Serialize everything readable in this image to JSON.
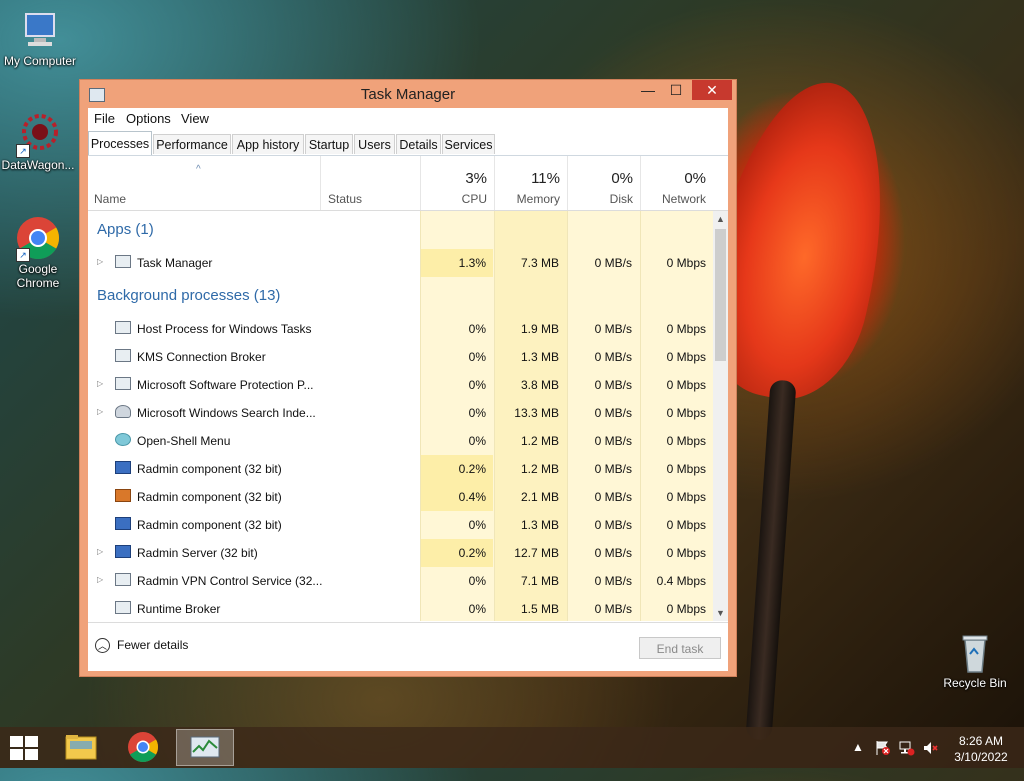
{
  "desktop": {
    "icons": [
      {
        "label": "My Computer"
      },
      {
        "label": "DataWagon..."
      },
      {
        "label": "Google Chrome"
      },
      {
        "label": "Recycle Bin"
      }
    ]
  },
  "window": {
    "title": "Task Manager",
    "controls": {
      "minimize": "—",
      "maximize": "☐",
      "close": "✕"
    },
    "menu": [
      "File",
      "Options",
      "View"
    ],
    "tabs": [
      "Processes",
      "Performance",
      "App history",
      "Startup",
      "Users",
      "Details",
      "Services"
    ],
    "active_tab": "Processes",
    "columns": {
      "name": "Name",
      "status": "Status",
      "cpu": {
        "pct": "3%",
        "label": "CPU"
      },
      "memory": {
        "pct": "11%",
        "label": "Memory"
      },
      "disk": {
        "pct": "0%",
        "label": "Disk"
      },
      "network": {
        "pct": "0%",
        "label": "Network"
      }
    },
    "groups": {
      "apps": "Apps (1)",
      "background": "Background processes (13)"
    },
    "apps": [
      {
        "name": "Task Manager",
        "cpu": "1.3%",
        "memory": "7.3 MB",
        "disk": "0 MB/s",
        "network": "0 Mbps",
        "expandable": true,
        "icon": "taskmanager-icon"
      }
    ],
    "background": [
      {
        "name": "Host Process for Windows Tasks",
        "cpu": "0%",
        "memory": "1.9 MB",
        "disk": "0 MB/s",
        "network": "0 Mbps",
        "expandable": false,
        "icon": "window-icon"
      },
      {
        "name": "KMS Connection Broker",
        "cpu": "0%",
        "memory": "1.3 MB",
        "disk": "0 MB/s",
        "network": "0 Mbps",
        "expandable": false,
        "icon": "window-icon"
      },
      {
        "name": "Microsoft Software Protection P...",
        "cpu": "0%",
        "memory": "3.8 MB",
        "disk": "0 MB/s",
        "network": "0 Mbps",
        "expandable": true,
        "icon": "window-icon"
      },
      {
        "name": "Microsoft Windows Search Inde...",
        "cpu": "0%",
        "memory": "13.3 MB",
        "disk": "0 MB/s",
        "network": "0 Mbps",
        "expandable": true,
        "icon": "user-icon"
      },
      {
        "name": "Open-Shell Menu",
        "cpu": "0%",
        "memory": "1.2 MB",
        "disk": "0 MB/s",
        "network": "0 Mbps",
        "expandable": false,
        "icon": "shell-icon"
      },
      {
        "name": "Radmin component (32 bit)",
        "cpu": "0.2%",
        "memory": "1.2 MB",
        "disk": "0 MB/s",
        "network": "0 Mbps",
        "expandable": false,
        "icon": "radmin-icon"
      },
      {
        "name": "Radmin component (32 bit)",
        "cpu": "0.4%",
        "memory": "2.1 MB",
        "disk": "0 MB/s",
        "network": "0 Mbps",
        "expandable": false,
        "icon": "radmin-orange-icon"
      },
      {
        "name": "Radmin component (32 bit)",
        "cpu": "0%",
        "memory": "1.3 MB",
        "disk": "0 MB/s",
        "network": "0 Mbps",
        "expandable": false,
        "icon": "radmin-icon"
      },
      {
        "name": "Radmin Server (32 bit)",
        "cpu": "0.2%",
        "memory": "12.7 MB",
        "disk": "0 MB/s",
        "network": "0 Mbps",
        "expandable": true,
        "icon": "radmin-icon"
      },
      {
        "name": "Radmin VPN Control Service (32...",
        "cpu": "0%",
        "memory": "7.1 MB",
        "disk": "0 MB/s",
        "network": "0.4 Mbps",
        "expandable": true,
        "icon": "window-icon"
      },
      {
        "name": "Runtime Broker",
        "cpu": "0%",
        "memory": "1.5 MB",
        "disk": "0 MB/s",
        "network": "0 Mbps",
        "expandable": false,
        "icon": "window-icon"
      }
    ],
    "footer": {
      "fewer_details": "Fewer details",
      "end_task": "End task"
    }
  },
  "taskbar": {
    "clock_time": "8:26 AM",
    "clock_date": "3/10/2022",
    "tray_chevron": "▲"
  },
  "colors": {
    "window_frame": "#f0a27a",
    "close_button": "#c7392e",
    "heat_light": "#fff7d6",
    "heat_medium": "#fdf0b8",
    "group_blue": "#2f6aa8"
  }
}
